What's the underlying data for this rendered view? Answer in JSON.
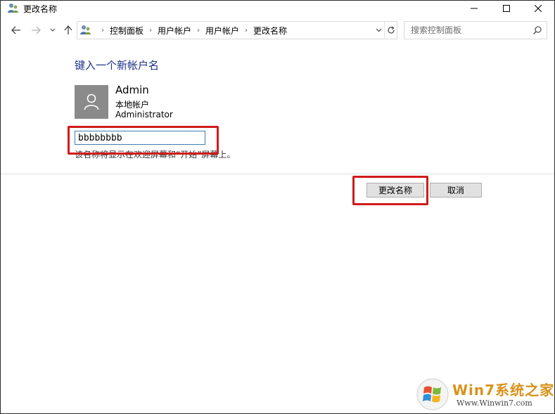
{
  "window": {
    "title": "更改名称",
    "controls": {
      "minimize": "minimize-icon",
      "maximize": "maximize-icon",
      "close": "close-icon"
    }
  },
  "nav": {
    "breadcrumbs": [
      "控制面板",
      "用户帐户",
      "用户帐户",
      "更改名称"
    ],
    "search_placeholder": "搜索控制面板"
  },
  "content": {
    "heading": "键入一个新帐户名",
    "account": {
      "name": "Admin",
      "type": "本地帐户",
      "group": "Administrator"
    },
    "new_name_value": "bbbbbbbb",
    "hint": "该名称将显示在欢迎屏幕和“开始”屏幕上。",
    "change_button": "更改名称",
    "cancel_button": "取消"
  },
  "colors": {
    "heading": "#1e3287",
    "highlight": "#d11a1a",
    "avatar": "#8a8a8a"
  },
  "watermark": {
    "line1": "Win7系统之家",
    "line2": "Www.Winwin7.com"
  }
}
